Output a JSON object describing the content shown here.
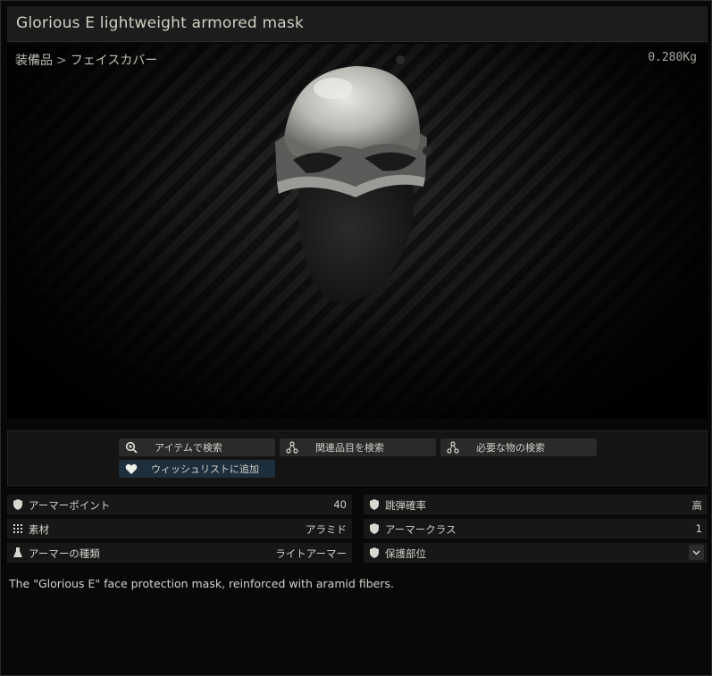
{
  "header": {
    "title": "Glorious E lightweight armored mask"
  },
  "breadcrumb": {
    "category": "装備品",
    "separator": ">",
    "subcategory": "フェイスカバー"
  },
  "weight": "0.280Kg",
  "actions": [
    {
      "label": "アイテムで検索",
      "icon": "search-plus-icon"
    },
    {
      "label": "関連品目を検索",
      "icon": "linked-nodes-icon"
    },
    {
      "label": "必要な物の検索",
      "icon": "linked-nodes-icon"
    },
    {
      "label": "ウィッシュリストに追加",
      "icon": "heart-icon"
    }
  ],
  "stats": {
    "armor_points": {
      "label": "アーマーポイント",
      "value": "40",
      "icon": "shield-icon"
    },
    "ricochet": {
      "label": "跳弾確率",
      "value": "高",
      "icon": "shield-icon"
    },
    "material": {
      "label": "素材",
      "value": "アラミド",
      "icon": "grid-dots-icon"
    },
    "armor_class": {
      "label": "アーマークラス",
      "value": "1",
      "icon": "shield-icon"
    },
    "armor_type": {
      "label": "アーマーの種類",
      "value": "ライトアーマー",
      "icon": "flask-icon"
    },
    "protected_areas": {
      "label": "保護部位",
      "icon": "shield-icon"
    }
  },
  "description": "The \"Glorious E\" face protection mask, reinforced with aramid fibers.",
  "colors": {
    "background": "#080808",
    "panel": "#171717",
    "button": "#2a2a2a",
    "wishlist_button": "#1d2f3d",
    "text": "#d0d0c8"
  }
}
